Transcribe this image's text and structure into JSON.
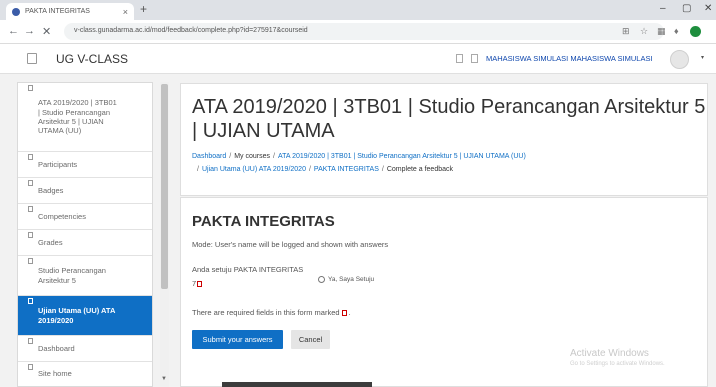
{
  "browser": {
    "tab_title": "PAKTA INTEGRITAS",
    "tab_close": "×",
    "new_tab": "+",
    "url": "v-class.gunadarma.ac.id/mod/feedback/complete.php?id=275917&courseid",
    "back": "←",
    "forward": "→",
    "reload": "✕",
    "win_min": "–",
    "win_max": "▢",
    "win_close": "✕"
  },
  "header": {
    "brand": "UG V-CLASS",
    "user_name": "MAHASISWA SIMULASI MAHASISWA SIMULASI",
    "caret": "▾"
  },
  "nav": {
    "items": [
      {
        "label": "ATA 2019/2020 | 3TB01 | Studio Perancangan Arsitektur 5 | UJIAN UTAMA (UU)",
        "active": false
      },
      {
        "label": "Participants",
        "active": false
      },
      {
        "label": "Badges",
        "active": false
      },
      {
        "label": "Competencies",
        "active": false
      },
      {
        "label": "Grades",
        "active": false
      },
      {
        "label": "Studio Perancangan Arsitektur 5",
        "active": false
      },
      {
        "label": "Ujian Utama (UU) ATA 2019/2020",
        "active": true
      },
      {
        "label": "Dashboard",
        "active": false
      },
      {
        "label": "Site home",
        "active": false
      }
    ]
  },
  "main": {
    "title": "ATA 2019/2020 | 3TB01 | Studio Perancangan Arsitektur 5 | UJIAN UTAMA",
    "breadcrumb_line1": {
      "dashboard": "Dashboard",
      "my_courses": "My courses",
      "course": "ATA 2019/2020 | 3TB01 | Studio Perancangan Arsitektur 5 | UJIAN UTAMA (UU)"
    },
    "breadcrumb_line2": {
      "section": "Ujian Utama (UU) ATA 2019/2020",
      "activity": "PAKTA INTEGRITAS",
      "current": "Complete a feedback"
    },
    "separator": "/"
  },
  "form": {
    "title": "PAKTA INTEGRITAS",
    "mode_text": "Mode: User's name will be logged and shown with answers",
    "question_label": "Anda setuju PAKTA INTEGRITAS",
    "question_number": "7",
    "radio_label": "Ya, Saya Setuju",
    "required_note_before": "There are required fields in this form marked",
    "required_note_after": ".",
    "submit_label": "Submit your answers",
    "cancel_label": "Cancel"
  },
  "watermark": {
    "line1": "Activate Windows",
    "line2": "Go to Settings to activate Windows."
  }
}
